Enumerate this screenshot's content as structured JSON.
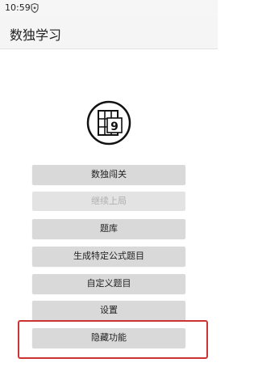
{
  "status_bar": {
    "time": "10:59",
    "icon": "shield-icon"
  },
  "app_bar": {
    "title": "数独学习"
  },
  "logo": {
    "icon": "sudoku-grid-icon",
    "digit": "9"
  },
  "menu": {
    "items": [
      {
        "label": "数独闯关",
        "enabled": true
      },
      {
        "label": "继续上局",
        "enabled": false
      },
      {
        "label": "题库",
        "enabled": true
      },
      {
        "label": "生成特定公式题目",
        "enabled": true
      },
      {
        "label": "自定义题目",
        "enabled": true
      },
      {
        "label": "设置",
        "enabled": true
      },
      {
        "label": "隐藏功能",
        "enabled": true
      }
    ]
  },
  "colors": {
    "highlight": "#cc3333",
    "button": "#d9d9d9",
    "button_disabled_text": "#b0b0b0"
  }
}
